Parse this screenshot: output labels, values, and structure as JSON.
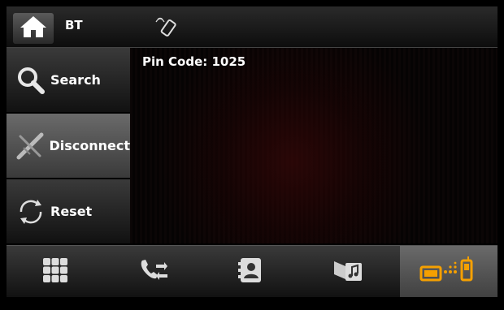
{
  "topbar": {
    "title": "BT",
    "home_icon": "home-icon",
    "status_icon": "phone-signal-icon"
  },
  "sidebar": {
    "items": [
      {
        "label": "Search",
        "icon": "search-icon"
      },
      {
        "label": "Disconnect",
        "icon": "disconnect-icon"
      },
      {
        "label": "Reset",
        "icon": "reset-icon"
      }
    ]
  },
  "main": {
    "pin_text": "Pin Code: 1025"
  },
  "bottombar": {
    "items": [
      {
        "icon": "dialpad-icon"
      },
      {
        "icon": "call-transfer-icon"
      },
      {
        "icon": "contacts-icon"
      },
      {
        "icon": "music-icon"
      },
      {
        "icon": "phone-pairing-icon",
        "active": true
      }
    ]
  },
  "colors": {
    "accent": "#f5a000",
    "text": "#ffffff"
  }
}
